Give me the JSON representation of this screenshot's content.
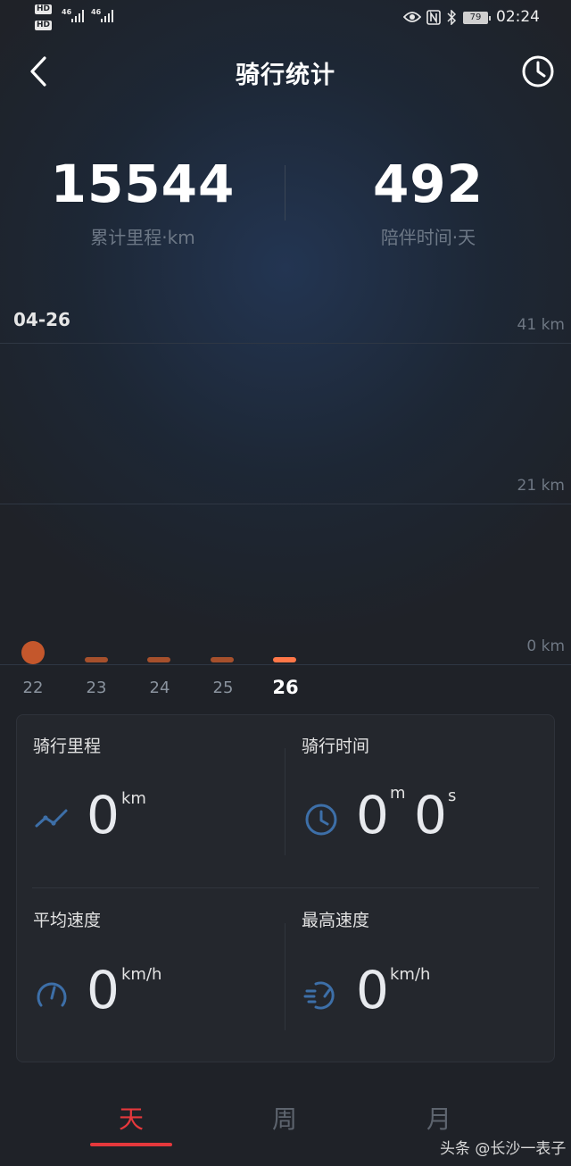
{
  "status_bar": {
    "hd1": "HD",
    "hd2": "HD",
    "net1": "46",
    "net2": "46",
    "battery": "79",
    "time": "02:24",
    "icons": [
      "eye-icon",
      "nfc-icon",
      "bluetooth-icon"
    ]
  },
  "header": {
    "title": "骑行统计",
    "back_icon": "chevron-left-icon",
    "history_icon": "clock-icon"
  },
  "totals": {
    "distance_value": "15544",
    "distance_label": "累计里程·km",
    "days_value": "492",
    "days_label": "陪伴时间·天"
  },
  "chart": {
    "selected_date": "04-26",
    "accent": "#e06a3a"
  },
  "chart_data": {
    "type": "bar",
    "title": "",
    "xlabel": "",
    "ylabel": "",
    "categories": [
      "22",
      "23",
      "24",
      "25",
      "26"
    ],
    "values": [
      0,
      0,
      0,
      0,
      0
    ],
    "selected": "26",
    "y_ticks": [
      "41 km",
      "21 km",
      "0 km"
    ],
    "ylim": [
      0,
      41
    ],
    "grid": true
  },
  "stats": {
    "distance": {
      "label": "骑行里程",
      "value": "0",
      "unit": "km"
    },
    "time": {
      "label": "骑行时间",
      "minutes": "0",
      "minutes_unit": "m",
      "seconds": "0",
      "seconds_unit": "s"
    },
    "avg_speed": {
      "label": "平均速度",
      "value": "0",
      "unit": "km/h"
    },
    "max_speed": {
      "label": "最高速度",
      "value": "0",
      "unit": "km/h"
    }
  },
  "tabs": {
    "day": "天",
    "week": "周",
    "month": "月",
    "active": "day",
    "active_color": "#e5383c"
  },
  "watermark": "头条 @长沙一表子"
}
